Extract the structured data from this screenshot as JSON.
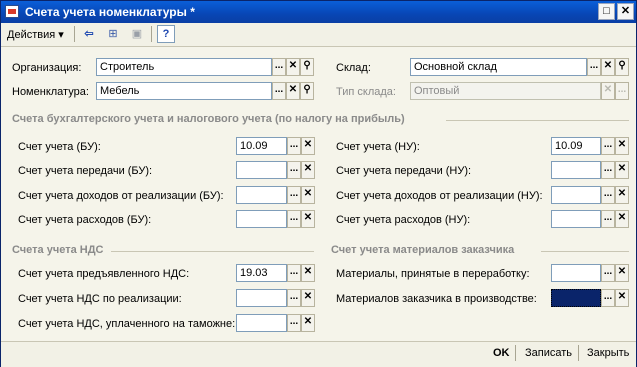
{
  "window": {
    "title": "Счета учета номенклатуры *",
    "controls": {
      "minimize": "_",
      "maximize": "□",
      "close": "✕"
    }
  },
  "toolbar": {
    "actions_label": "Действия ▾",
    "icons": [
      "back-arrow-icon",
      "copy-form-icon",
      "struct-icon",
      "help-icon"
    ],
    "help_glyph": "?",
    "back_glyph": "⇦",
    "struct_glyph": "⊞",
    "copy_glyph": "▣"
  },
  "header": {
    "org_label": "Организация:",
    "org_value": "Строитель",
    "nom_label": "Номенклатура:",
    "nom_value": "Мебель",
    "sklad_label": "Склад:",
    "sklad_value": "Основной склад",
    "tip_label": "Тип склада:",
    "tip_value": "Оптовый"
  },
  "buttons": {
    "dots": "...",
    "clear": "✕",
    "search": "⚲"
  },
  "section_accounting": {
    "title": "Счета бухгалтерского учета и налогового учета (по налогу на прибыль)",
    "left": [
      {
        "label": "Счет учета (БУ):",
        "value": "10.09"
      },
      {
        "label": "Счет учета передачи (БУ):",
        "value": ""
      },
      {
        "label": "Счет учета доходов от реализации (БУ):",
        "value": ""
      },
      {
        "label": "Счет учета расходов (БУ):",
        "value": ""
      }
    ],
    "right": [
      {
        "label": "Счет учета (НУ):",
        "value": "10.09"
      },
      {
        "label": "Счет учета передачи (НУ):",
        "value": ""
      },
      {
        "label": "Счет учета доходов от реализации (НУ):",
        "value": ""
      },
      {
        "label": "Счет учета расходов (НУ):",
        "value": ""
      }
    ]
  },
  "section_vat": {
    "title": "Счета учета НДС",
    "rows": [
      {
        "label": "Счет учета предъявленного НДС:",
        "value": "19.03"
      },
      {
        "label": "Счет учета НДС по реализации:",
        "value": ""
      },
      {
        "label": "Счет учета НДС, уплаченного на таможне:",
        "value": ""
      }
    ]
  },
  "section_customer": {
    "title": "Счет учета материалов заказчика",
    "rows": [
      {
        "label": "Материалы, принятые в переработку:",
        "value": ""
      },
      {
        "label": "Материалов заказчика в производстве:",
        "value": ""
      }
    ]
  },
  "footer": {
    "ok": "OK",
    "save": "Записать",
    "close": "Закрыть"
  }
}
